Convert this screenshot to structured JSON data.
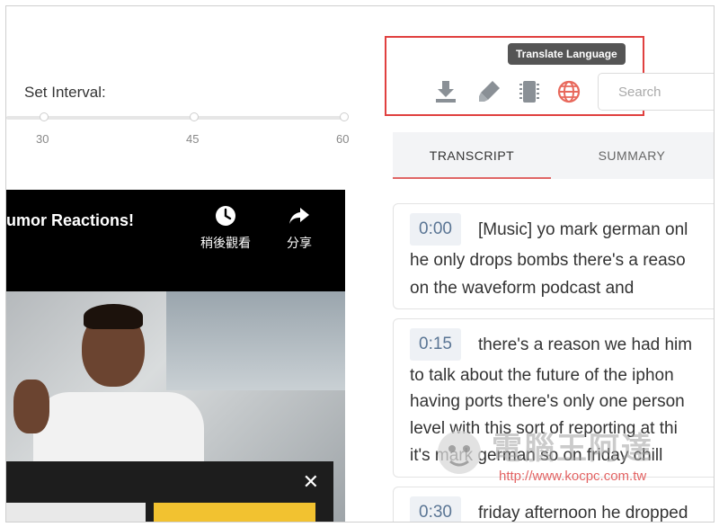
{
  "interval": {
    "label": "Set Interval:",
    "ticks": [
      "30",
      "45",
      "60"
    ]
  },
  "video": {
    "title": "umor Reactions!",
    "watch_later": "稍後觀看",
    "share": "分享"
  },
  "toolbar": {
    "tooltip": "Translate Language",
    "search_placeholder": "Search"
  },
  "tabs": [
    {
      "label": "TRANSCRIPT",
      "active": true
    },
    {
      "label": "SUMMARY",
      "active": false
    }
  ],
  "transcript": [
    {
      "time": "0:00",
      "lines": [
        "[Music] yo mark german onl",
        "he only drops bombs there's a reaso",
        "on the waveform podcast and"
      ]
    },
    {
      "time": "0:15",
      "lines": [
        "there's a reason we had him",
        "to talk about the future of the iphon",
        "having ports there's only one person",
        "level with this sort of reporting at thi",
        "it's mark german so on friday chill"
      ]
    },
    {
      "time": "0:30",
      "lines": [
        "friday afternoon he dropped"
      ]
    }
  ],
  "watermark": {
    "text": "電腦王阿達",
    "url": "http://www.kocpc.com.tw"
  },
  "colors": {
    "highlight": "#e0403f",
    "tab_active": "#e06666",
    "timestamp_text": "#5a7594",
    "globe_icon": "#e8695c"
  }
}
